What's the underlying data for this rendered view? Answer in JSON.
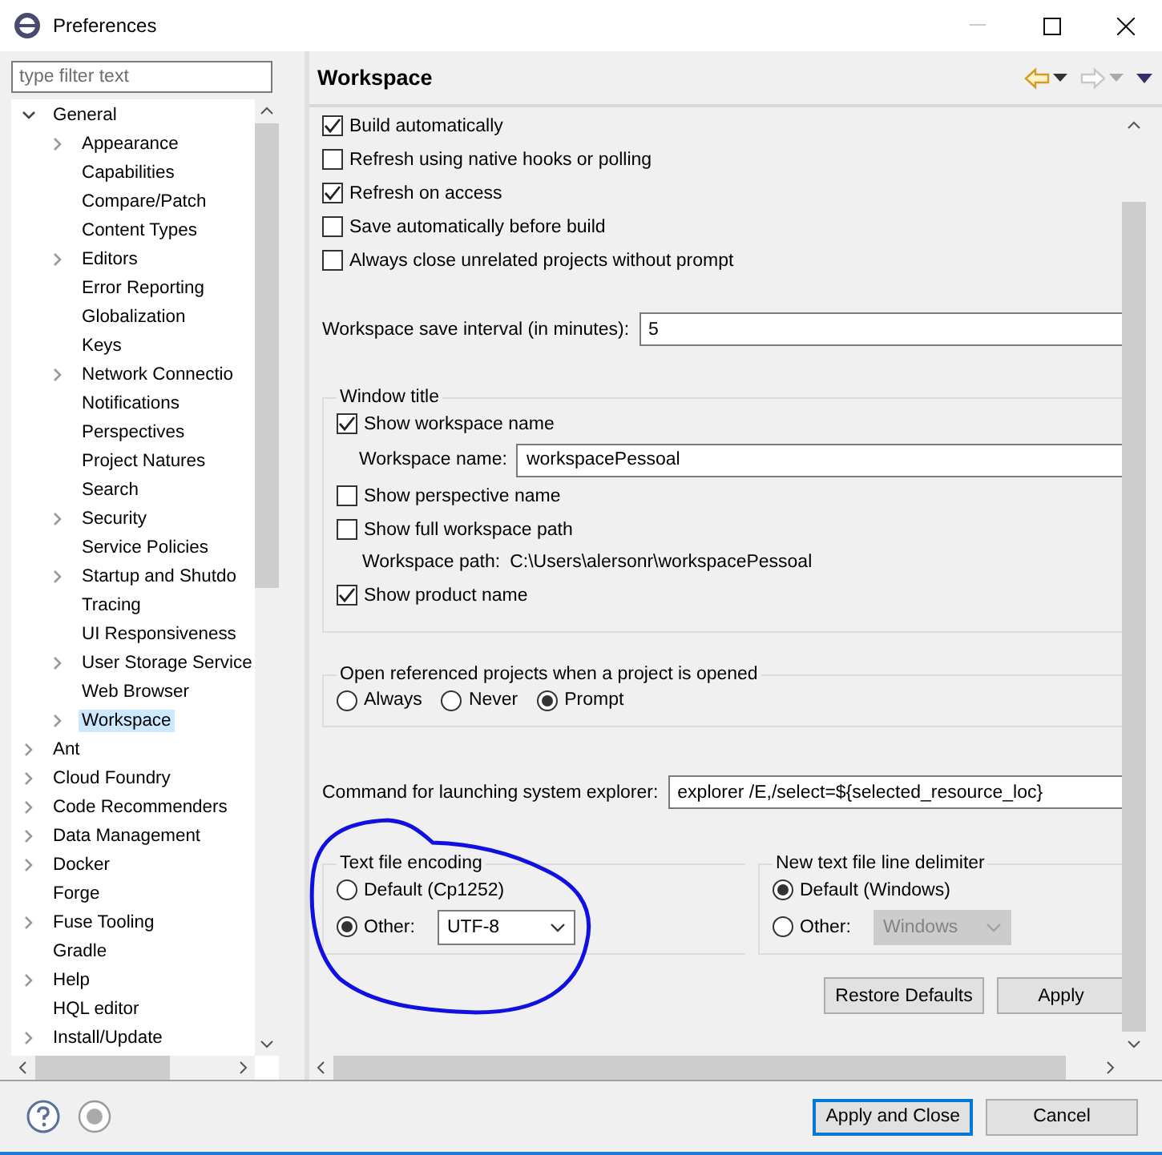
{
  "window": {
    "title": "Preferences"
  },
  "filter": {
    "placeholder": "type filter text"
  },
  "tree": [
    {
      "label": "General",
      "expanded": true,
      "selected": false,
      "children": [
        {
          "label": "Appearance",
          "expanded": false,
          "selected": false
        },
        {
          "label": "Capabilities",
          "selected": false
        },
        {
          "label": "Compare/Patch",
          "selected": false
        },
        {
          "label": "Content Types",
          "selected": false
        },
        {
          "label": "Editors",
          "expanded": false,
          "selected": false
        },
        {
          "label": "Error Reporting",
          "selected": false
        },
        {
          "label": "Globalization",
          "selected": false
        },
        {
          "label": "Keys",
          "selected": false
        },
        {
          "label": "Network Connectio",
          "expanded": false,
          "selected": false
        },
        {
          "label": "Notifications",
          "selected": false
        },
        {
          "label": "Perspectives",
          "selected": false
        },
        {
          "label": "Project Natures",
          "selected": false
        },
        {
          "label": "Search",
          "selected": false
        },
        {
          "label": "Security",
          "expanded": false,
          "selected": false
        },
        {
          "label": "Service Policies",
          "selected": false
        },
        {
          "label": "Startup and Shutdo",
          "expanded": false,
          "selected": false
        },
        {
          "label": "Tracing",
          "selected": false
        },
        {
          "label": "UI Responsiveness",
          "selected": false
        },
        {
          "label": "User Storage Service",
          "expanded": false,
          "selected": false
        },
        {
          "label": "Web Browser",
          "selected": false
        },
        {
          "label": "Workspace",
          "expanded": false,
          "selected": true
        }
      ]
    },
    {
      "label": "Ant",
      "expanded": false,
      "selected": false
    },
    {
      "label": "Cloud Foundry",
      "expanded": false,
      "selected": false
    },
    {
      "label": "Code Recommenders",
      "expanded": false,
      "selected": false
    },
    {
      "label": "Data Management",
      "expanded": false,
      "selected": false
    },
    {
      "label": "Docker",
      "expanded": false,
      "selected": false
    },
    {
      "label": "Forge",
      "selected": false
    },
    {
      "label": "Fuse Tooling",
      "expanded": false,
      "selected": false
    },
    {
      "label": "Gradle",
      "selected": false
    },
    {
      "label": "Help",
      "expanded": false,
      "selected": false
    },
    {
      "label": "HQL editor",
      "selected": false
    },
    {
      "label": "Install/Update",
      "expanded": false,
      "selected": false
    }
  ],
  "page": {
    "title": "Workspace"
  },
  "options": [
    {
      "label": "Build automatically",
      "checked": true
    },
    {
      "label": "Refresh using native hooks or polling",
      "checked": false
    },
    {
      "label": "Refresh on access",
      "checked": true
    },
    {
      "label": "Save automatically before build",
      "checked": false
    },
    {
      "label": "Always close unrelated projects without prompt",
      "checked": false
    }
  ],
  "save_interval": {
    "label": "Workspace save interval (in minutes):",
    "value": "5"
  },
  "window_title_group": {
    "title": "Window title",
    "items": [
      {
        "kind": "checkbox",
        "label": "Show workspace name",
        "checked": true
      },
      {
        "kind": "field",
        "label": "Workspace name:",
        "value": "workspacePessoal"
      },
      {
        "kind": "checkbox",
        "label": "Show perspective name",
        "checked": false
      },
      {
        "kind": "checkbox",
        "label": "Show full workspace path",
        "checked": false
      },
      {
        "kind": "path",
        "label": "Workspace path:",
        "value": "C:\\Users\\alersonr\\workspacePessoal"
      },
      {
        "kind": "checkbox",
        "label": "Show product name",
        "checked": true
      }
    ]
  },
  "open_referenced": {
    "title": "Open referenced projects when a project is opened",
    "options": [
      {
        "label": "Always",
        "selected": false
      },
      {
        "label": "Never",
        "selected": false
      },
      {
        "label": "Prompt",
        "selected": true
      }
    ]
  },
  "explorer_command": {
    "label": "Command for launching system explorer:",
    "value": "explorer /E,/select=${selected_resource_loc}"
  },
  "encoding": {
    "title": "Text file encoding",
    "options": [
      {
        "label": "Default (Cp1252)",
        "selected": false
      },
      {
        "label": "Other:",
        "selected": true,
        "select": {
          "value": "UTF-8",
          "disabled": false
        }
      }
    ]
  },
  "line_delimiter": {
    "title": "New text file line delimiter",
    "options": [
      {
        "label": "Default (Windows)",
        "selected": true
      },
      {
        "label": "Other:",
        "selected": false,
        "select": {
          "value": "Windows",
          "disabled": true
        }
      }
    ]
  },
  "page_buttons": [
    "Restore Defaults",
    "Apply"
  ],
  "dialog_buttons": [
    {
      "label": "Apply and Close",
      "default": true
    },
    {
      "label": "Cancel",
      "default": false
    }
  ]
}
